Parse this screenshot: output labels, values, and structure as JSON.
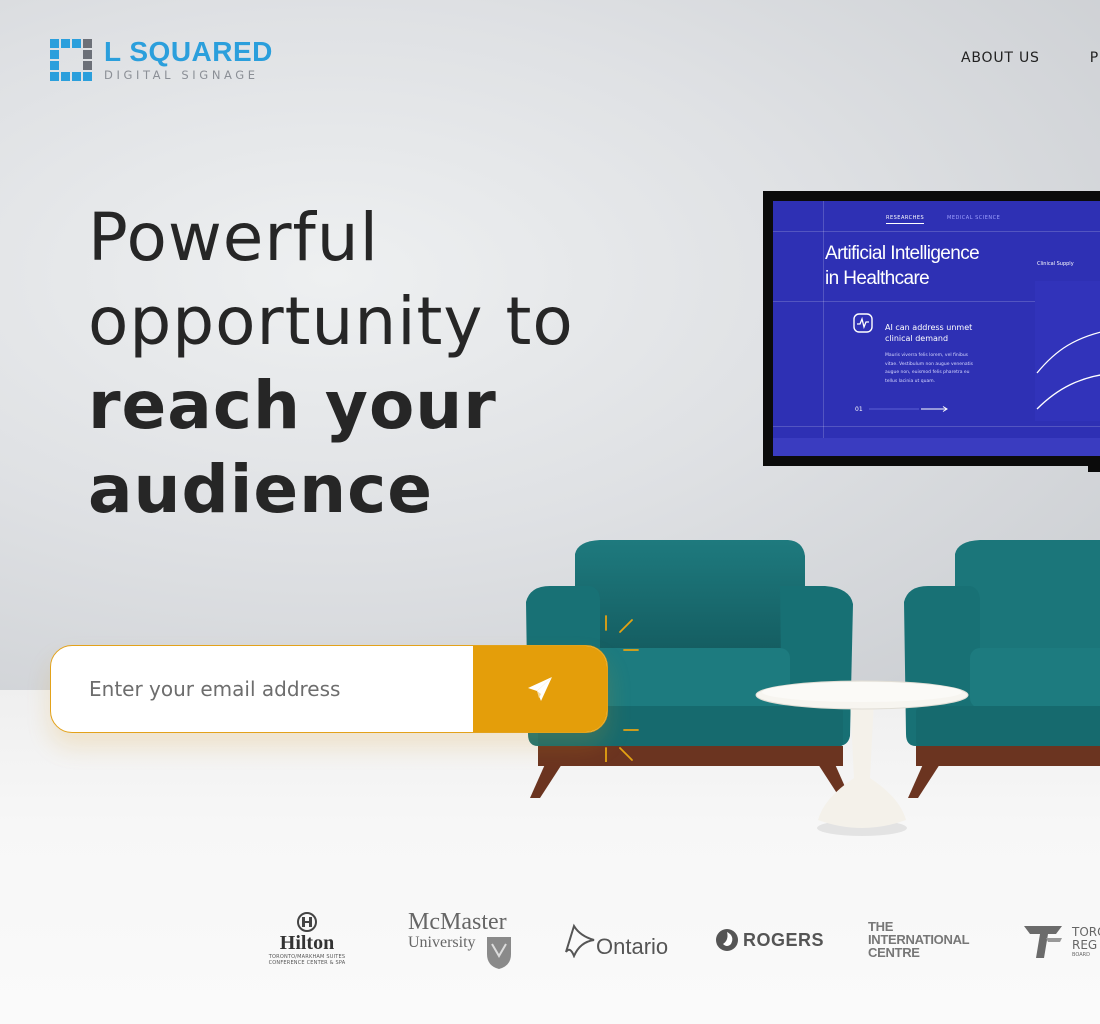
{
  "brand": {
    "name": "L SQUARED",
    "tagline": "DIGITAL SIGNAGE",
    "color": "#2b9fdc"
  },
  "nav": {
    "items": [
      {
        "label": "ABOUT US"
      },
      {
        "label": "P"
      }
    ]
  },
  "hero": {
    "line1": "Powerful",
    "line2": "opportunity to",
    "line3": "reach your",
    "line4": "audience"
  },
  "email_form": {
    "placeholder": "Enter your email address",
    "button_icon": "paper-plane-icon",
    "accent": "#e49e0a"
  },
  "tv_screen": {
    "tab_active": "RESEARCHES",
    "tab_inactive": "MEDICAL SCIENCE",
    "headline_line1": "Artificial Intelligence",
    "headline_line2": "in Healthcare",
    "side_label": "Clinical Supply",
    "card_title": "AI can address unmet clinical demand",
    "card_body": "Mauris viverra felis lorem, vel finibus vitae. Vestibulum non augue venenatis augue non, euismod felis pharetra eu tellus lacinia ut quam.",
    "slide_number": "01",
    "background": "#2e30b4"
  },
  "partners": [
    {
      "name": "Hilton",
      "sub": "TORONTO/MARKHAM SUITES CONFERENCE CENTER & SPA"
    },
    {
      "name": "McMaster",
      "sub": "University"
    },
    {
      "name": "Ontario"
    },
    {
      "name": "ROGERS"
    },
    {
      "name": "THE INTERNATIONAL CENTRE"
    },
    {
      "name": "TORO",
      "sub": "REG",
      "sub2": "BOARD"
    }
  ]
}
